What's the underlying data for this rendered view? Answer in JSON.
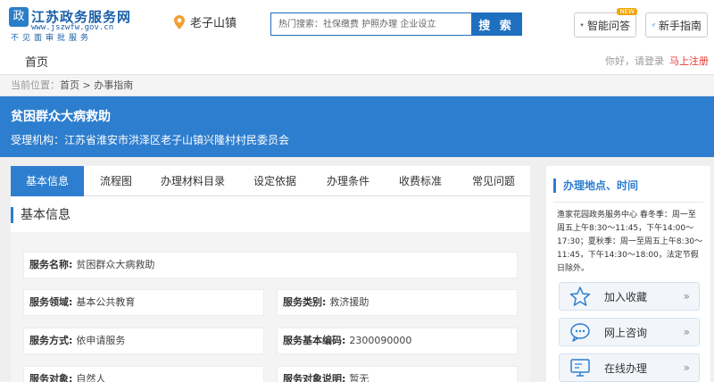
{
  "header": {
    "logo_mark": "政",
    "logo_title": "江苏政务服务网",
    "logo_url": "www.jszwfw.gov.cn",
    "logo_slogan": "不见面审批服务",
    "location": "老子山镇",
    "search_placeholder": "热门搜索：社保缴费 护照办理 企业设立",
    "search_button": "搜 索",
    "smart_qa": "智能问答",
    "smart_qa_badge": "NEW",
    "guide": "新手指南"
  },
  "nav": {
    "home": "首页",
    "greeting": "你好，请登录",
    "register": "马上注册"
  },
  "breadcrumb": {
    "prefix": "当前位置：",
    "home": "首页",
    "sep": " > ",
    "current": "办事指南"
  },
  "banner": {
    "title": "贫困群众大病救助",
    "org": "受理机构：江苏省淮安市洪泽区老子山镇兴隆村村民委员会"
  },
  "tabs": [
    {
      "label": "基本信息"
    },
    {
      "label": "流程图"
    },
    {
      "label": "办理材料目录"
    },
    {
      "label": "设定依据"
    },
    {
      "label": "办理条件"
    },
    {
      "label": "收费标准"
    },
    {
      "label": "常见问题"
    }
  ],
  "section_title": "基本信息",
  "info": {
    "service_name": {
      "label": "服务名称:",
      "value": "贫困群众大病救助"
    },
    "service_field": {
      "label": "服务领域:",
      "value": "基本公共教育"
    },
    "service_category": {
      "label": "服务类别:",
      "value": "救济援助"
    },
    "service_method": {
      "label": "服务方式:",
      "value": "依申请服务"
    },
    "service_code": {
      "label": "服务基本编码:",
      "value": "2300090000"
    },
    "service_target": {
      "label": "服务对象:",
      "value": "自然人"
    },
    "service_target_desc": {
      "label": "服务对象说明:",
      "value": "暂无"
    }
  },
  "right": {
    "title": "办理地点、时间",
    "office_text": "渔家花园政务服务中心 春冬季：周一至周五上午8:30～11:45，下午14:00～17:30；夏秋季：周一至周五上午8:30～11:45，下午14:30～18:00，法定节假日除外。",
    "actions": [
      {
        "label": "加入收藏",
        "icon": "star-icon"
      },
      {
        "label": "网上咨询",
        "icon": "chat-icon"
      },
      {
        "label": "在线办理",
        "icon": "monitor-icon"
      }
    ],
    "arrow": "»"
  },
  "colors": {
    "primary": "#2d7ecf",
    "register": "#e03a2f",
    "badge": "#f0a500"
  }
}
